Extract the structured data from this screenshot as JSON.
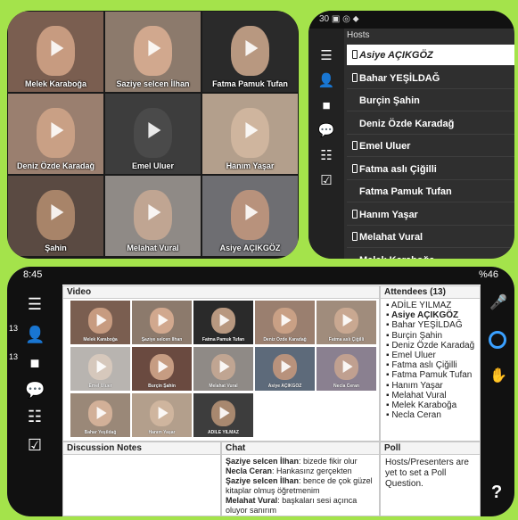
{
  "top_grid": {
    "tiles": [
      {
        "name": "Melek Karaboğa",
        "bg": "#7a5e50",
        "face": "#c79b80"
      },
      {
        "name": "Saziye selcen İlhan",
        "bg": "#8c7a6c",
        "face": "#d1a88e"
      },
      {
        "name": "Fatma Pamuk Tufan",
        "bg": "#2a2a2a",
        "face": "#b89880"
      },
      {
        "name": "Deniz Özde Karadağ",
        "bg": "#9a7f6f",
        "face": "#c9a085"
      },
      {
        "name": "Emel Uluer",
        "bg": "#3d3d3d",
        "face": "#4a4a4a"
      },
      {
        "name": "Hanım Yaşar",
        "bg": "#b39f8c",
        "face": "#cfb59e"
      },
      {
        "name": "Şahin",
        "bg": "#5a4a42",
        "face": "#a88469"
      },
      {
        "name": "Melahat Vural",
        "bg": "#8f8a86",
        "face": "#c0a592"
      },
      {
        "name": "Asiye AÇIKGÖZ",
        "bg": "#6e6e72",
        "face": "#b8927c"
      }
    ]
  },
  "hosts_panel": {
    "status_text": "30",
    "header": "Hosts",
    "items": [
      {
        "label": "Asiye AÇIKGÖZ",
        "selected": true,
        "device": true,
        "indent": false
      },
      {
        "label": "Bahar YEŞİLDAĞ",
        "selected": false,
        "device": true,
        "indent": false
      },
      {
        "label": "Burçin Şahin",
        "selected": false,
        "device": false,
        "indent": true
      },
      {
        "label": "Deniz Özde Karadağ",
        "selected": false,
        "device": false,
        "indent": true
      },
      {
        "label": "Emel Uluer",
        "selected": false,
        "device": true,
        "indent": false
      },
      {
        "label": "Fatma aslı Çiğilli",
        "selected": false,
        "device": true,
        "indent": false
      },
      {
        "label": "Fatma Pamuk Tufan",
        "selected": false,
        "device": false,
        "indent": true
      },
      {
        "label": "Hanım Yaşar",
        "selected": false,
        "device": true,
        "indent": false
      },
      {
        "label": "Melahat Vural",
        "selected": false,
        "device": true,
        "indent": false
      },
      {
        "label": "Melek Karaboğa",
        "selected": false,
        "device": false,
        "indent": true
      }
    ]
  },
  "main": {
    "status_time": "8:45",
    "status_right": "%46",
    "side_count_1": "13",
    "side_count_2": "13",
    "video_title": "Video",
    "video_tiles": [
      {
        "name": "Melek Karaboğa",
        "bg": "#7a5e50",
        "face": "#c79b80"
      },
      {
        "name": "Şaziye selcen İlhan",
        "bg": "#8c7a6c",
        "face": "#d1a88e"
      },
      {
        "name": "Fatma Pamuk Tufan",
        "bg": "#2a2a2a",
        "face": "#b89880"
      },
      {
        "name": "Deniz Özde Karadağ",
        "bg": "#9a7f6f",
        "face": "#c9a085"
      },
      {
        "name": "Fatma aslı Çiğilli",
        "bg": "#a08c7c",
        "face": "#c9a891"
      },
      {
        "name": "Emel Uluer",
        "bg": "#b8b4b0",
        "face": "#d6c8bc"
      },
      {
        "name": "Burçin Şahin",
        "bg": "#6a4a40",
        "face": "#c69c82"
      },
      {
        "name": "Melahat Vural",
        "bg": "#8f8a86",
        "face": "#c0a592"
      },
      {
        "name": "Asiye AÇIKGÖZ",
        "bg": "#5d6a7a",
        "face": "#b8927c"
      },
      {
        "name": "Necla Ceran",
        "bg": "#8a8090",
        "face": "#c0a090"
      },
      {
        "name": "Bahar Yeşildağ",
        "bg": "#9a8878",
        "face": "#d2b098"
      },
      {
        "name": "Hanım Yaşar",
        "bg": "#b39f8c",
        "face": "#cfb59e"
      },
      {
        "name": "ADİLE YILMAZ",
        "bg": "#3d3d3d",
        "face": "#a8886f"
      }
    ],
    "attendees_title": "Attendees (13)",
    "attendees": [
      {
        "name": "ADİLE YILMAZ",
        "bold": false
      },
      {
        "name": "Asiye AÇIKGÖZ",
        "bold": true
      },
      {
        "name": "Bahar YEŞİLDAĞ",
        "bold": false
      },
      {
        "name": "Burçin Şahin",
        "bold": false
      },
      {
        "name": "Deniz Özde Karadağ",
        "bold": false
      },
      {
        "name": "Emel Uluer",
        "bold": false
      },
      {
        "name": "Fatma aslı Çiğilli",
        "bold": false
      },
      {
        "name": "Fatma Pamuk Tufan",
        "bold": false
      },
      {
        "name": "Hanım Yaşar",
        "bold": false
      },
      {
        "name": "Melahat Vural",
        "bold": false
      },
      {
        "name": "Melek Karaboğa",
        "bold": false
      },
      {
        "name": "Necla Ceran",
        "bold": false
      }
    ],
    "notes_title": "Discussion Notes",
    "chat_title": "Chat",
    "chat": [
      {
        "author": "Şaziye selcen İlhan",
        "text": ": bizede fikir olur"
      },
      {
        "author": "Necla Ceran",
        "text": ": Hankasınz gerçekten"
      },
      {
        "author": "Şaziye selcen İlhan",
        "text": ": bence de çok güzel kitaplar olmuş öğretmenim"
      },
      {
        "author": "Melahat Vural",
        "text": ": başkaları sesi açınca oluyor sanırım"
      }
    ],
    "poll_title": "Poll",
    "poll_text": "Hosts/Presenters are yet to set a Poll Question."
  },
  "colors": {
    "background": "#a4e34b",
    "dark_panel": "#2f2f2f",
    "selected_row": "#ffffff"
  }
}
